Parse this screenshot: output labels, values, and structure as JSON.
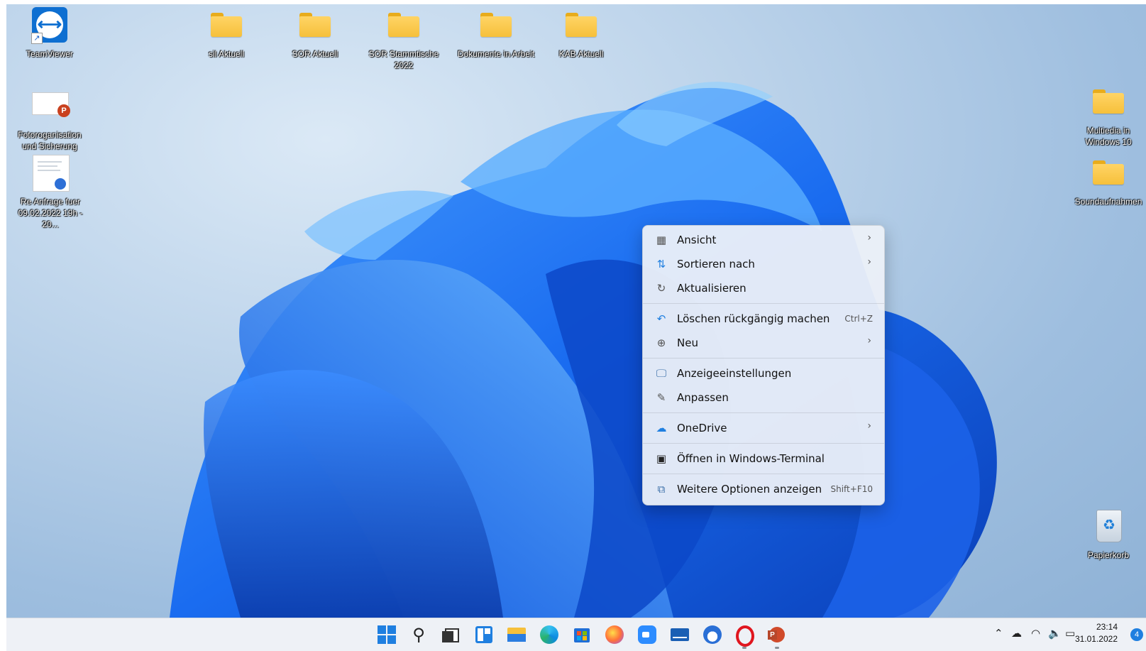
{
  "colors": {
    "accent": "#1f7fe0",
    "folder": "#f6c03b",
    "menu_bg": "#ecf0f8",
    "taskbar_bg": "#eef1f6"
  },
  "desktop": {
    "icons": [
      {
        "label": "TeamViewer",
        "icon": "teamviewer-icon"
      },
      {
        "label": "sil Aktuell",
        "icon": "folder-icon"
      },
      {
        "label": "SOR Aktuell",
        "icon": "folder-icon"
      },
      {
        "label": "SOR Stammtische 2022",
        "icon": "folder-icon"
      },
      {
        "label": "Dokumente in Arbeit",
        "icon": "folder-icon"
      },
      {
        "label": "KAB Aktuell",
        "icon": "folder-icon"
      },
      {
        "label": "Fotoroganisation und Sicherung",
        "icon": "powerpoint-file-icon"
      },
      {
        "label": "Re  Anfrage fuer 09.02.2022 19h - 20...",
        "icon": "thunderbird-mail-icon"
      },
      {
        "label": "Multiedia in Windows 10",
        "icon": "folder-icon"
      },
      {
        "label": "Soundaufnahmen",
        "icon": "folder-icon"
      },
      {
        "label": "Papierkorb",
        "icon": "recycle-bin-icon"
      }
    ]
  },
  "context_menu": {
    "items": [
      {
        "label": "Ansicht",
        "icon": "view-grid-icon",
        "submenu": true
      },
      {
        "label": "Sortieren nach",
        "icon": "sort-icon",
        "submenu": true
      },
      {
        "label": "Aktualisieren",
        "icon": "refresh-icon"
      },
      {
        "label": "Löschen rückgängig machen",
        "icon": "undo-icon",
        "shortcut": "Ctrl+Z"
      },
      {
        "label": "Neu",
        "icon": "new-plus-icon",
        "submenu": true
      },
      {
        "label": "Anzeigeeinstellungen",
        "icon": "display-settings-icon"
      },
      {
        "label": "Anpassen",
        "icon": "personalize-brush-icon"
      },
      {
        "label": "OneDrive",
        "icon": "onedrive-cloud-icon",
        "submenu": true
      },
      {
        "label": "Öffnen in Windows-Terminal",
        "icon": "terminal-icon"
      },
      {
        "label": "Weitere Optionen anzeigen",
        "icon": "more-options-icon",
        "shortcut": "Shift+F10"
      }
    ]
  },
  "taskbar": {
    "apps": [
      "start-icon",
      "search-icon",
      "task-view-icon",
      "widgets-icon",
      "file-explorer-icon",
      "edge-icon",
      "store-icon",
      "firefox-icon",
      "zoom-icon",
      "mail-icon",
      "thunderbird-icon",
      "opera-icon",
      "powerpoint-icon"
    ],
    "tray": {
      "time": "23:14",
      "date": "31.01.2022",
      "notifications": "4"
    }
  }
}
